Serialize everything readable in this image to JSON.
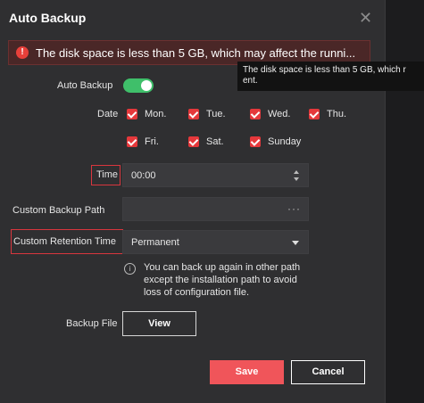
{
  "dialog": {
    "title": "Auto Backup",
    "close_icon": "close-icon"
  },
  "warning": {
    "icon": "!",
    "text": "The disk space is less than 5 GB, which may affect the runni...",
    "tooltip_line1": "The disk space is less than 5 GB, which r",
    "tooltip_line2": "ent."
  },
  "auto_backup": {
    "label": "Auto Backup",
    "enabled": true,
    "accent_color": "#3fbf6a"
  },
  "date": {
    "label": "Date",
    "days": [
      {
        "label": "Mon.",
        "checked": true
      },
      {
        "label": "Tue.",
        "checked": true
      },
      {
        "label": "Wed.",
        "checked": true
      },
      {
        "label": "Thu.",
        "checked": true
      },
      {
        "label": "Fri.",
        "checked": true
      },
      {
        "label": "Sat.",
        "checked": true
      },
      {
        "label": "Sunday",
        "checked": true
      }
    ]
  },
  "time": {
    "label": "Time",
    "value": "00:00"
  },
  "custom_backup_path": {
    "label": "Custom Backup Path",
    "value": "",
    "browse": "···"
  },
  "retention": {
    "label": "Custom Retention Time",
    "value": "Permanent"
  },
  "info": {
    "icon": "i",
    "line1": "You can back up again in other path",
    "line2": "except the installation path to avoid",
    "line3": "loss of configuration file."
  },
  "backup_file": {
    "label": "Backup File",
    "button": "View"
  },
  "actions": {
    "save": "Save",
    "cancel": "Cancel"
  },
  "colors": {
    "primary": "#f0555a",
    "checkbox": "#e5383b",
    "highlight": "#d9363e",
    "warning_bg": "#4a2727"
  }
}
